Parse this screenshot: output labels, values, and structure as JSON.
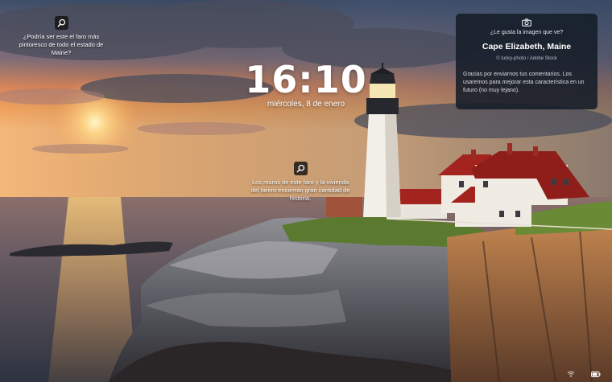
{
  "clock": {
    "time": "16:10",
    "date": "miércoles, 8 de enero"
  },
  "hotspots": [
    {
      "text": "¿Podría ser este el faro más pintoresco de todo el estado de Maine?",
      "icon": "search-icon"
    },
    {
      "text": "Los muros de este faro y la vivienda del farero encierran gran cantidad de historia.",
      "icon": "search-icon"
    }
  ],
  "info_card": {
    "icon": "camera-icon",
    "question": "¿Le gusta la imagen que ve?",
    "location": "Cape Elizabeth, Maine",
    "credit": "© lucky-photo / Adobe Stock",
    "feedback": "Gracias por enviarnos tus comentarios. Los usaremos para mejorar esta característica en un futuro (no muy lejano)."
  },
  "status_icons": [
    "network-icon",
    "battery-icon"
  ],
  "colors": {
    "card_bg": "#141c28",
    "icon_bg": "#141414",
    "text": "#ffffff"
  }
}
